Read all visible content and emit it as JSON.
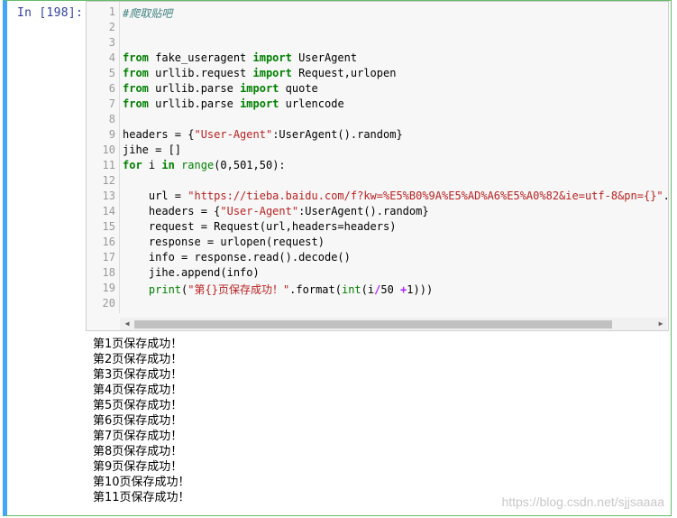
{
  "prompt_label": "In  [198]:",
  "code_lines": [
    {
      "n": "1",
      "parts": [
        {
          "t": "#爬取贴吧",
          "c": "cmt"
        }
      ]
    },
    {
      "n": "2",
      "parts": []
    },
    {
      "n": "3",
      "parts": []
    },
    {
      "n": "4",
      "parts": [
        {
          "t": "from",
          "c": "kw"
        },
        {
          "t": " fake_useragent ",
          "c": ""
        },
        {
          "t": "import",
          "c": "kw"
        },
        {
          "t": " UserAgent",
          "c": ""
        }
      ]
    },
    {
      "n": "5",
      "parts": [
        {
          "t": "from",
          "c": "kw"
        },
        {
          "t": " urllib.request ",
          "c": ""
        },
        {
          "t": "import",
          "c": "kw"
        },
        {
          "t": " Request,urlopen",
          "c": ""
        }
      ]
    },
    {
      "n": "6",
      "parts": [
        {
          "t": "from",
          "c": "kw"
        },
        {
          "t": " urllib.parse ",
          "c": ""
        },
        {
          "t": "import",
          "c": "kw"
        },
        {
          "t": " quote",
          "c": ""
        }
      ]
    },
    {
      "n": "7",
      "parts": [
        {
          "t": "from",
          "c": "kw"
        },
        {
          "t": " urllib.parse ",
          "c": ""
        },
        {
          "t": "import",
          "c": "kw"
        },
        {
          "t": " urlencode",
          "c": ""
        }
      ]
    },
    {
      "n": "8",
      "parts": []
    },
    {
      "n": "9",
      "parts": [
        {
          "t": "headers = {",
          "c": ""
        },
        {
          "t": "\"User-Agent\"",
          "c": "str"
        },
        {
          "t": ":UserAgent().random}",
          "c": ""
        }
      ]
    },
    {
      "n": "10",
      "parts": [
        {
          "t": "jihe = []",
          "c": ""
        }
      ]
    },
    {
      "n": "11",
      "parts": [
        {
          "t": "for",
          "c": "kw"
        },
        {
          "t": " i ",
          "c": ""
        },
        {
          "t": "in",
          "c": "kw"
        },
        {
          "t": " ",
          "c": ""
        },
        {
          "t": "range",
          "c": "bi"
        },
        {
          "t": "(0,501,50):",
          "c": ""
        }
      ]
    },
    {
      "n": "12",
      "parts": []
    },
    {
      "n": "13",
      "parts": [
        {
          "t": "    url = ",
          "c": ""
        },
        {
          "t": "\"https://tieba.baidu.com/f?kw=%E5%B0%9A%E5%AD%A6%E5%A0%82&ie=utf-8&pn={}\"",
          "c": "str"
        },
        {
          "t": ".fo",
          "c": ""
        }
      ]
    },
    {
      "n": "14",
      "parts": [
        {
          "t": "    headers = {",
          "c": ""
        },
        {
          "t": "\"User-Agent\"",
          "c": "str"
        },
        {
          "t": ":UserAgent().random}",
          "c": ""
        }
      ]
    },
    {
      "n": "15",
      "parts": [
        {
          "t": "    request = Request(url,headers=headers)",
          "c": ""
        }
      ]
    },
    {
      "n": "16",
      "parts": [
        {
          "t": "    response = urlopen(request)",
          "c": ""
        }
      ]
    },
    {
      "n": "17",
      "parts": [
        {
          "t": "    info = response.read().decode()",
          "c": ""
        }
      ]
    },
    {
      "n": "18",
      "parts": [
        {
          "t": "    jihe.append(info)",
          "c": ""
        }
      ]
    },
    {
      "n": "19",
      "parts": [
        {
          "t": "    ",
          "c": ""
        },
        {
          "t": "print",
          "c": "bi"
        },
        {
          "t": "(",
          "c": ""
        },
        {
          "t": "\"第{}页保存成功！\"",
          "c": "str"
        },
        {
          "t": ".format(",
          "c": ""
        },
        {
          "t": "int",
          "c": "bi"
        },
        {
          "t": "(i",
          "c": ""
        },
        {
          "t": "/",
          "c": "op"
        },
        {
          "t": "50 ",
          "c": ""
        },
        {
          "t": "+",
          "c": "op"
        },
        {
          "t": "1)))",
          "c": ""
        }
      ]
    },
    {
      "n": "20",
      "parts": []
    }
  ],
  "output_lines": [
    "第1页保存成功！",
    "第2页保存成功！",
    "第3页保存成功！",
    "第4页保存成功！",
    "第5页保存成功！",
    "第6页保存成功！",
    "第7页保存成功！",
    "第8页保存成功！",
    "第9页保存成功！",
    "第10页保存成功！",
    "第11页保存成功！"
  ],
  "scroll_left_icon": "arrow-left-icon",
  "scroll_right_icon": "arrow-right-icon",
  "scroll_left_glyph": "◀",
  "scroll_right_glyph": "▶",
  "watermark": "https://blog.csdn.net/sjjsaaaa"
}
